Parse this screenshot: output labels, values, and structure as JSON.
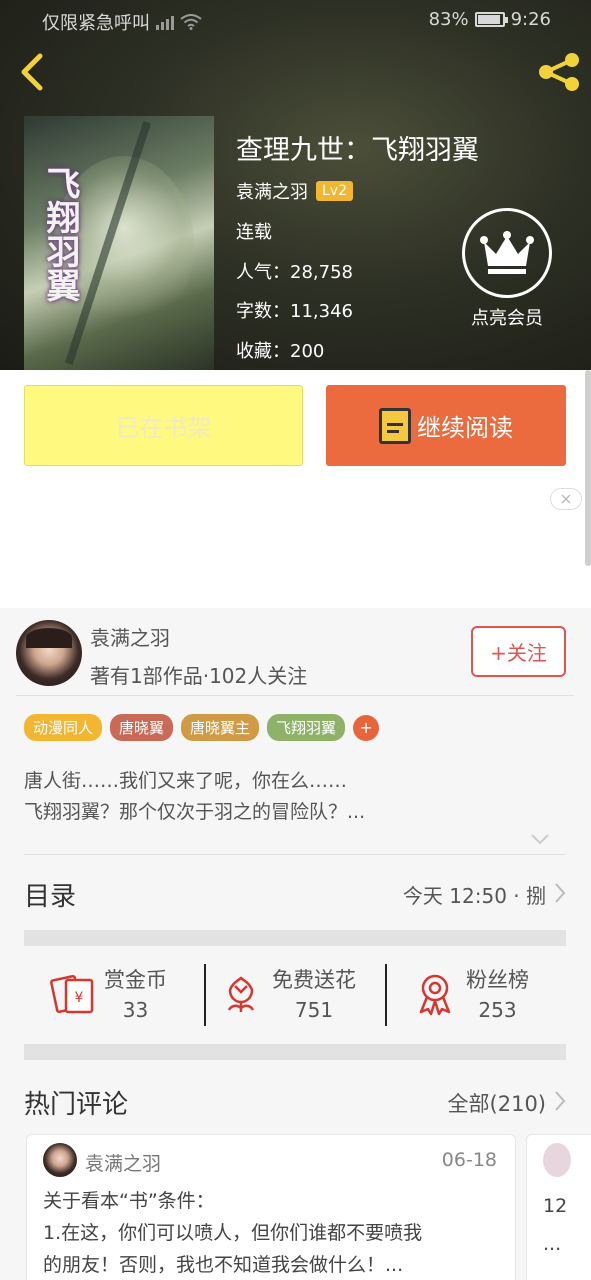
{
  "status_bar": {
    "carrier": "仅限紧急呼叫",
    "battery": "83%",
    "time": "9:26"
  },
  "book": {
    "title": "查理九世：飞翔羽翼",
    "cover_text": "飞翔羽翼",
    "author": "袁满之羽",
    "author_level": "Lv2",
    "status": "连载",
    "popularity": "人气：28,758",
    "word_count": "字数：11,346",
    "favorites": "收藏：200",
    "member_label": "点亮会员"
  },
  "actions": {
    "shelf_label": "已在书架",
    "read_label": "继续阅读"
  },
  "author_section": {
    "name": "袁满之羽",
    "info": "著有1部作品·102人关注",
    "follow_label": "+关注",
    "tags": [
      {
        "label": "动漫同人",
        "color": "#f2b632"
      },
      {
        "label": "唐晓翼",
        "color": "#c86a56"
      },
      {
        "label": "唐晓翼主",
        "color": "#cf9b45"
      },
      {
        "label": "飞翔羽翼",
        "color": "#8fb16a"
      }
    ],
    "tag_add": "+",
    "intro_line1": "唐人街……我们又来了呢，你在么……",
    "intro_line2": "飞翔羽翼？那个仅次于羽之的冒险队？..."
  },
  "toc": {
    "title": "目录",
    "update": "今天 12:50 · 捌"
  },
  "stats": [
    {
      "label": "赏金币",
      "value": "33",
      "icon": "red-envelope-icon"
    },
    {
      "label": "免费送花",
      "value": "751",
      "icon": "flower-icon"
    },
    {
      "label": "粉丝榜",
      "value": "253",
      "icon": "medal-icon"
    }
  ],
  "comments": {
    "title": "热门评论",
    "all_label": "全部(210)",
    "items": [
      {
        "user": "袁满之羽",
        "date": "06-18",
        "line1": "关于看本“书”条件：",
        "line2": "1.在这，你们可以喷人，但你们谁都不要喷我",
        "line3": "的朋友！否则，我也不知道我会做什么！..."
      }
    ],
    "peek_line1": "12",
    "peek_line2": "..."
  }
}
